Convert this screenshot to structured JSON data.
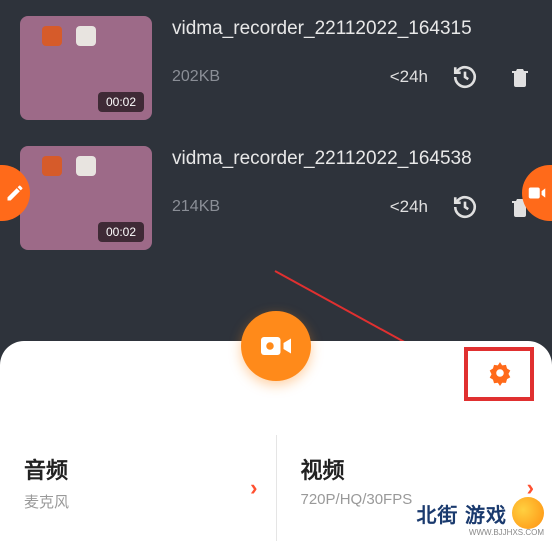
{
  "recordings": [
    {
      "title": "vidma_recorder_22112022_164315",
      "duration": "00:02",
      "size": "202KB",
      "age": "<24h"
    },
    {
      "title": "vidma_recorder_22112022_164538",
      "duration": "00:02",
      "size": "214KB",
      "age": "<24h"
    }
  ],
  "options": {
    "audio": {
      "title": "音频",
      "subtitle": "麦克风"
    },
    "video": {
      "title": "视频",
      "subtitle": "720P/HQ/30FPS"
    }
  },
  "watermark": {
    "text": "北街  游戏",
    "url": "WWW.BJJHXS.COM"
  }
}
